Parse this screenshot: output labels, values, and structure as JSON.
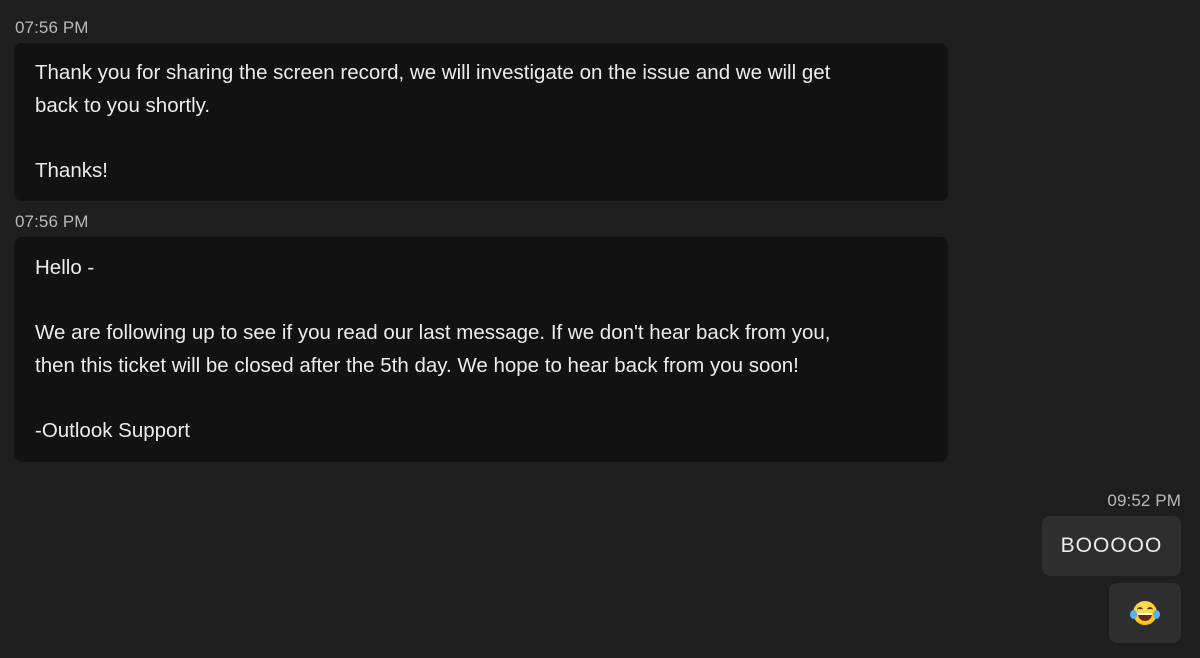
{
  "messages": [
    {
      "timestamp": "07:56 PM",
      "lines": [
        "Thank you for sharing the screen record, we will investigate on the issue and we will get",
        "back to you shortly.",
        "",
        "Thanks!"
      ]
    },
    {
      "timestamp": "07:56 PM",
      "lines": [
        "Hello -",
        "",
        "We are following up to see if you read our last message. If we don't hear back from you,",
        "then this ticket will be closed after the 5th day. We hope to hear back from you soon!",
        "",
        "-Outlook Support"
      ]
    }
  ],
  "outgoing": {
    "timestamp": "09:52 PM",
    "text": "BOOOOO",
    "emoji_icon": "face-with-tears-of-joy-icon"
  },
  "colors": {
    "background": "#1e1e1e",
    "incoming_bubble": "#121212",
    "outgoing_bubble": "#2e2e2e",
    "text": "#ececec",
    "timestamp": "#b9b9b9"
  }
}
